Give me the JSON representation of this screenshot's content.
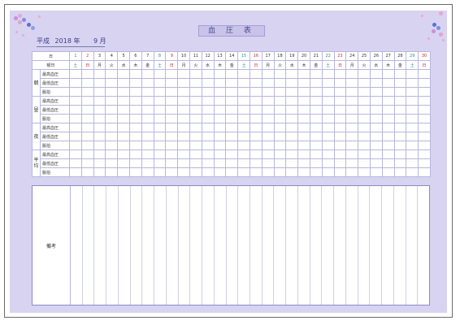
{
  "title": "血 圧 表",
  "period": {
    "era": "平成",
    "year": "2018",
    "year_suffix": "年",
    "month": "9",
    "month_suffix": "月"
  },
  "header": {
    "day_label": "日",
    "weekday_label": "曜日",
    "days": [
      "1",
      "2",
      "3",
      "4",
      "5",
      "6",
      "7",
      "8",
      "9",
      "10",
      "11",
      "12",
      "13",
      "14",
      "15",
      "16",
      "17",
      "18",
      "19",
      "20",
      "21",
      "22",
      "23",
      "24",
      "25",
      "26",
      "27",
      "28",
      "29",
      "30"
    ],
    "weekdays": [
      "土",
      "日",
      "月",
      "火",
      "水",
      "木",
      "金",
      "土",
      "日",
      "月",
      "火",
      "水",
      "木",
      "金",
      "土",
      "日",
      "月",
      "火",
      "水",
      "木",
      "金",
      "土",
      "日",
      "月",
      "火",
      "水",
      "木",
      "金",
      "土",
      "日"
    ]
  },
  "groups": [
    {
      "label": "朝",
      "rows": [
        "最高血圧",
        "最低血圧",
        "脈拍"
      ]
    },
    {
      "label": "昼",
      "rows": [
        "最高血圧",
        "最低血圧",
        "脈拍"
      ]
    },
    {
      "label": "夜",
      "rows": [
        "最高血圧",
        "最低血圧",
        "脈拍"
      ]
    },
    {
      "label": "平均",
      "rows": [
        "最高血圧",
        "最低血圧",
        "脈拍"
      ]
    }
  ],
  "memo_label": "備考",
  "colors": {
    "saturday": "#2e8c8c",
    "sunday": "#d12a2a",
    "background": "#d8d3f0",
    "border": "#8c89c8"
  }
}
